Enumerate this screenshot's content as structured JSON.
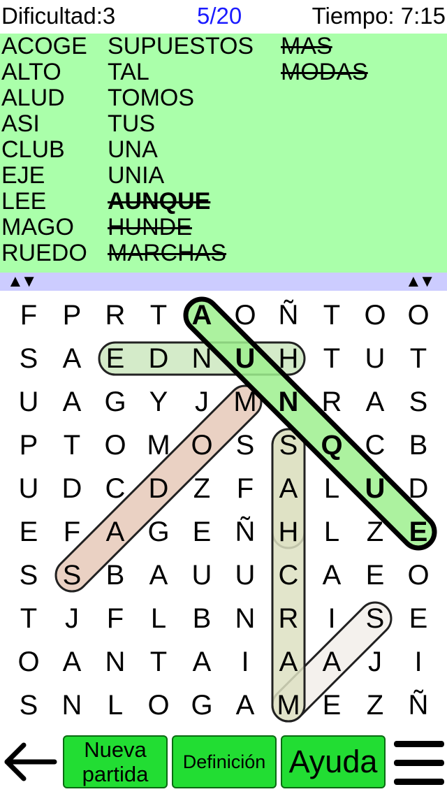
{
  "header": {
    "difficulty": "Dificultad:3",
    "progress": "5/20",
    "timer": "Tiempo: 7:15"
  },
  "words": {
    "col1": [
      {
        "text": "ACOGE",
        "found": false
      },
      {
        "text": "ALTO",
        "found": false
      },
      {
        "text": "ALUD",
        "found": false
      },
      {
        "text": "ASI",
        "found": false
      },
      {
        "text": "CLUB",
        "found": false
      },
      {
        "text": "EJE",
        "found": false
      },
      {
        "text": "LEE",
        "found": false
      },
      {
        "text": "MAGO",
        "found": false
      },
      {
        "text": "RUEDO",
        "found": false
      }
    ],
    "col2": [
      {
        "text": "SUPUESTOS",
        "found": false
      },
      {
        "text": "TAL",
        "found": false
      },
      {
        "text": "TOMOS",
        "found": false
      },
      {
        "text": "TUS",
        "found": false
      },
      {
        "text": "UNA",
        "found": false
      },
      {
        "text": "UNIA",
        "found": false
      },
      {
        "text": "AUNQUE",
        "found": true,
        "current": true
      },
      {
        "text": "HUNDE",
        "found": true
      },
      {
        "text": "MARCHAS",
        "found": true
      }
    ],
    "col3": [
      {
        "text": "MAS",
        "found": true
      },
      {
        "text": "MODAS",
        "found": true
      }
    ]
  },
  "scroll": {
    "left_arrows": "▲▼",
    "right_arrows": "▲▼"
  },
  "grid": {
    "rows": [
      [
        "F",
        "P",
        "R",
        "T",
        "A",
        "O",
        "Ñ",
        "T",
        "O",
        "O"
      ],
      [
        "S",
        "A",
        "E",
        "D",
        "N",
        "U",
        "H",
        "T",
        "U",
        "T"
      ],
      [
        "U",
        "A",
        "G",
        "Y",
        "J",
        "M",
        "N",
        "R",
        "A",
        "S"
      ],
      [
        "P",
        "T",
        "O",
        "M",
        "O",
        "S",
        "S",
        "Q",
        "C",
        "B"
      ],
      [
        "U",
        "D",
        "C",
        "D",
        "Z",
        "F",
        "A",
        "L",
        "U",
        "D"
      ],
      [
        "E",
        "F",
        "A",
        "G",
        "E",
        "Ñ",
        "H",
        "L",
        "Z",
        "E"
      ],
      [
        "S",
        "S",
        "B",
        "A",
        "U",
        "U",
        "C",
        "A",
        "E",
        "O"
      ],
      [
        "T",
        "J",
        "F",
        "L",
        "B",
        "N",
        "R",
        "I",
        "S",
        "E"
      ],
      [
        "O",
        "A",
        "N",
        "T",
        "A",
        "I",
        "A",
        "A",
        "J",
        "I"
      ],
      [
        "S",
        "N",
        "L",
        "O",
        "G",
        "A",
        "M",
        "E",
        "Z",
        "Ñ"
      ]
    ],
    "bold_cells": [
      [
        0,
        4
      ],
      [
        1,
        5
      ],
      [
        2,
        6
      ],
      [
        3,
        7
      ],
      [
        4,
        8
      ],
      [
        5,
        9
      ]
    ],
    "highlights": [
      {
        "from": [
          9,
          6
        ],
        "to": [
          7,
          8
        ],
        "fill": "#f2eeea",
        "stroke": "#222222",
        "strokeWidth": 3
      },
      {
        "from": [
          5,
          6
        ],
        "to": [
          3,
          6
        ],
        "fill": "#e2e8cc",
        "stroke": "#222222",
        "strokeWidth": 3
      },
      {
        "from": [
          3,
          6
        ],
        "to": [
          9,
          6
        ],
        "fill": "#dde0c2",
        "stroke": "#222222",
        "strokeWidth": 3
      },
      {
        "from": [
          6,
          1
        ],
        "to": [
          2,
          5
        ],
        "fill": "#e6c9b8",
        "stroke": "#222222",
        "strokeWidth": 3
      },
      {
        "from": [
          1,
          6
        ],
        "to": [
          1,
          2
        ],
        "fill": "#cce8c0",
        "stroke": "#222222",
        "strokeWidth": 3
      },
      {
        "from": [
          0,
          4
        ],
        "to": [
          5,
          9
        ],
        "fill": "#9ef08e",
        "stroke": "#000000",
        "strokeWidth": 7
      }
    ]
  },
  "buttons": {
    "new_game": "Nueva partida",
    "definition": "Definición",
    "help": "Ayuda"
  },
  "icons": {
    "back": "arrow-left-icon",
    "menu": "hamburger-menu-icon"
  }
}
